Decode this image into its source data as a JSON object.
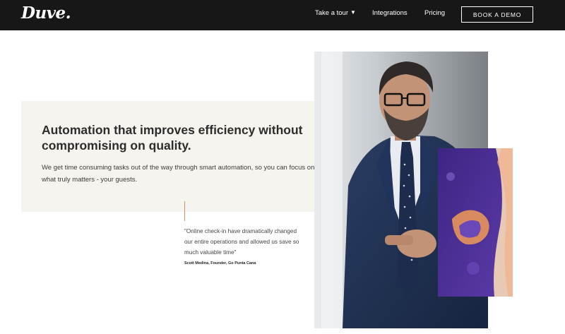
{
  "nav": {
    "logo": "Duve.",
    "items": [
      {
        "label": "Take a tour",
        "has_dropdown": true,
        "icon": "chevron-down-icon"
      },
      {
        "label": "Integrations"
      },
      {
        "label": "Pricing"
      }
    ],
    "cta_label": "BOOK A DEMO"
  },
  "hero": {
    "title": "Automation that improves efficiency without compromising on quality.",
    "body": "We get time consuming tasks out of the way through smart automation, so you can focus on what truly matters - your guests."
  },
  "testimonial": {
    "quote": "\"Online check-in have dramatically changed our entire operations and allowed us save so much valuable time\"",
    "author": "Scott Medina, Founder, Go Punta Cana"
  },
  "colors": {
    "nav_bg": "#171717",
    "card_bg": "#f6f4ee",
    "accent_line": "#c9926a",
    "overlay_purple": "#4a2f8f",
    "overlay_orange": "#e8955a"
  }
}
